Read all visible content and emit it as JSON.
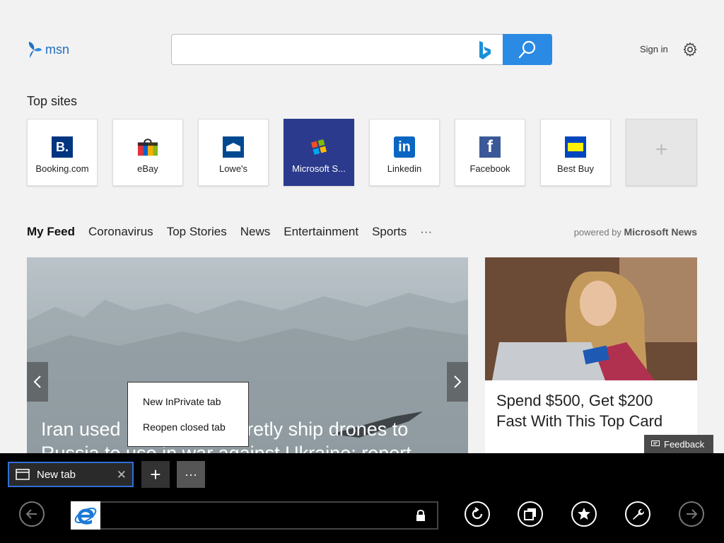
{
  "header": {
    "logo_text": "msn",
    "search": {
      "value": "",
      "placeholder": ""
    },
    "sign_in_label": "Sign in"
  },
  "top_sites": {
    "title": "Top sites",
    "items": [
      {
        "label": "Booking.com",
        "icon": "booking-icon"
      },
      {
        "label": "eBay",
        "icon": "ebay-icon"
      },
      {
        "label": "Lowe's",
        "icon": "lowes-icon"
      },
      {
        "label": "Microsoft S...",
        "icon": "microsoft-store-icon"
      },
      {
        "label": "Linkedin",
        "icon": "linkedin-icon"
      },
      {
        "label": "Facebook",
        "icon": "facebook-icon"
      },
      {
        "label": "Best Buy",
        "icon": "best-buy-icon"
      }
    ]
  },
  "feed": {
    "tabs": [
      "My Feed",
      "Coronavirus",
      "Top Stories",
      "News",
      "Entertainment",
      "Sports"
    ],
    "more_label": "···",
    "powered_by_prefix": "powered by",
    "powered_by_brand": "Microsoft News",
    "hero_title": "Iran used Belarus to secretly ship drones to Russia to use in war against Ukraine: report",
    "ad_title": "Spend $500, Get $200 Fast With This Top Card"
  },
  "context_menu": {
    "items": [
      "New InPrivate tab",
      "Reopen closed tab"
    ]
  },
  "feedback_label": "Feedback",
  "browser": {
    "tab_title": "New tab",
    "tab_close": "✕",
    "new_tab_symbol": "+",
    "tab_more_symbol": "···",
    "address_value": ""
  },
  "colors": {
    "accent_blue": "#2b8ae3",
    "msn_blue": "#1f6fbf",
    "tab_border": "#2f6fd6",
    "ms_store_tile": "#2b3a8c"
  }
}
